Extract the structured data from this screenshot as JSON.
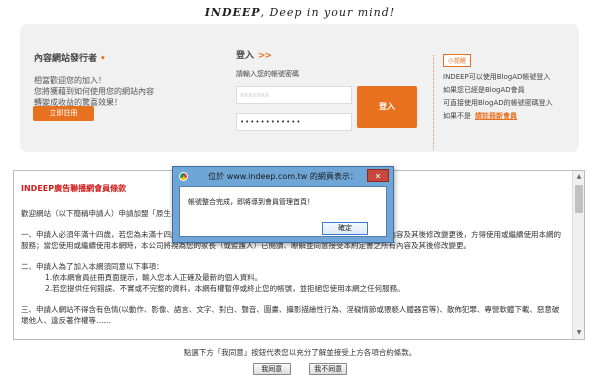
{
  "header": {
    "slogan_brand": "INDEEP",
    "slogan_rest": ", Deep in your mind!"
  },
  "publisher": {
    "title": "內容網站發行者",
    "title_mark": "•",
    "desc_line1": "相當歡迎您的加入！",
    "desc_line2": "您將獲藉到如何使用您的網站內容",
    "desc_line3": "轉變成收益的驚喜效果！",
    "register_label": "立即註冊"
  },
  "login": {
    "title": "登入",
    "arrows": ">>",
    "hint": "請輸入您的帳號密碼",
    "username_value": "xxxxxxx",
    "password_value": "••••••••••••",
    "button_label": "登入"
  },
  "tips": {
    "tag": "小提醒",
    "line1": "INDEEP可以使用BlogAD帳號登入",
    "line2": "如果您已經是BlogAD會員",
    "line3": "可直接使用BlogAD的帳號密碼登入",
    "line4": "如果不是",
    "line4_mid": "請",
    "line4_link": "註冊新會員"
  },
  "terms": {
    "title": "INDEEP廣告聯播網會員條款",
    "para1": "歡迎網站（以下簡稱申請人）申請加盟「原生…（略）…本網）必須同意及遵守以下條款（以下簡稱本條款）：",
    "para2": "一、申請人必須年滿十四歲，若您為未滿十四歲，應於您的家長（或監護人）閱讀、瞭解並同意本約定書之所有內容及其後修改變更後，方得使用或繼續使用本網的服務；當您使用或繼續使用本網時，本公司將視為您的家長（或監護人）已閱讀、瞭解並同意接受本約定書之所有內容及其後修改變更。",
    "para3_title": "二、申請人為了加入本網須同意以下事項：",
    "para3_item1": "1.依本網會員註冊頁面提示，輸入您本人正確及最新的個人資料。",
    "para3_item2": "2.若您提供任何錯誤、不實或不完整的資料，本網有權暫停或終止您的帳號，並拒絕您使用本網之任何服務。",
    "para4": "三、申請人網站不得含有色情(以動作、影像、語言、文字、對白、聲音、圖畫、攝影描繪性行為、淫穢情節或猥褻人體器官等)、散佈犯罪、專營軟體下載、惡意破壞他人、違反著作權等……"
  },
  "footer": {
    "agree_text": "點選下方「我同意」按鈕代表您以充分了解並接受上方各項合約條款。",
    "agree_button": "我同意",
    "disagree_button": "我不同意"
  },
  "alert": {
    "title": "位於 www.indeep.com.tw 的網頁表示：",
    "close_label": "✕",
    "message": "帳號整合完成，即將導到會員管理首頁！",
    "ok_label": "確定"
  }
}
